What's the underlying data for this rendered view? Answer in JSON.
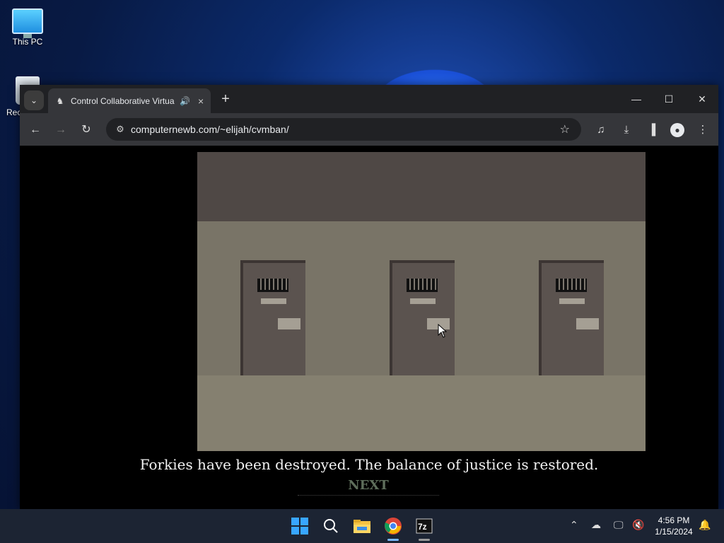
{
  "desktop": {
    "icons": [
      {
        "label": "This PC"
      },
      {
        "label": "Rec"
      }
    ]
  },
  "browser": {
    "tab": {
      "title": "Control Collaborative Virtua",
      "audio_icon": "speaker-icon",
      "close": "×"
    },
    "new_tab": "+",
    "address": "computernewb.com/~elijah/cvmban/",
    "window_controls": {
      "minimize": "—",
      "maximize": "☐",
      "close": "✕"
    }
  },
  "game": {
    "message": "Forkies have been destroyed. The balance of justice is restored.",
    "next_label": "NEXT",
    "colors": {
      "ceiling": "#4f4845",
      "wall": "#797467",
      "floor": "#858070",
      "door": "#5b534f"
    }
  },
  "taskbar": {
    "time": "4:56 PM",
    "date": "1/15/2024"
  }
}
